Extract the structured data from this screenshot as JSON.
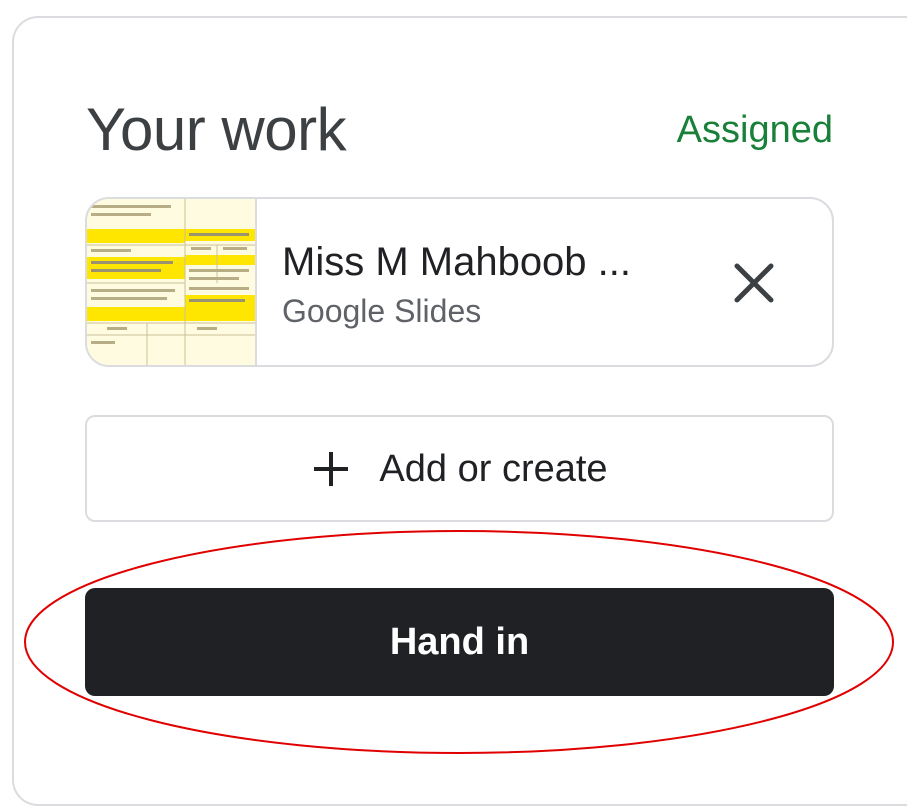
{
  "header": {
    "title": "Your work",
    "status": "Assigned"
  },
  "attachment": {
    "title": "Miss M Mahboob ...",
    "type": "Google Slides",
    "remove_icon": "close-icon"
  },
  "actions": {
    "add_label": "Add or create",
    "add_icon": "plus-icon",
    "hand_in_label": "Hand in"
  },
  "colors": {
    "status": "#188038",
    "primary_button": "#202124",
    "highlight": "#e00000",
    "thumbnail_yellow": "#ffe600"
  }
}
